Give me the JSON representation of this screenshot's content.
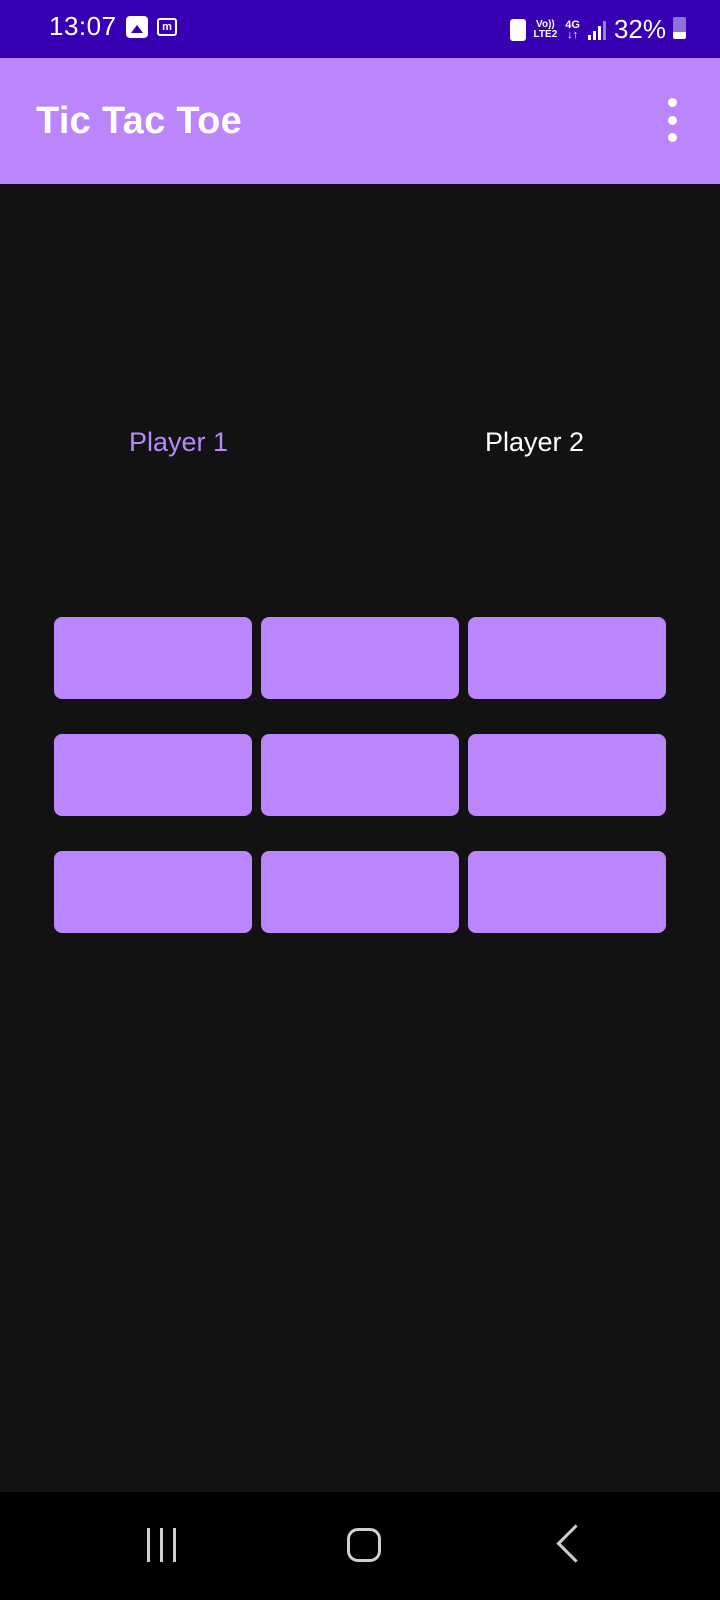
{
  "status_bar": {
    "time": "13:07",
    "left_icons": [
      "gallery-icon",
      "m-app-icon"
    ],
    "m_icon_label": "m",
    "volte_top": "Vo))",
    "volte_bottom": "LTE2",
    "network_type": "4G",
    "battery_percent": "32%",
    "battery_level": 0.32
  },
  "app_bar": {
    "title": "Tic Tac Toe",
    "menu_icon": "more-vert-icon"
  },
  "players": {
    "player_1": "Player 1",
    "player_2": "Player 2"
  },
  "board": {
    "cells": [
      [
        "",
        "",
        ""
      ],
      [
        "",
        "",
        ""
      ],
      [
        "",
        "",
        ""
      ]
    ]
  },
  "nav_bar": {
    "icons": [
      "recent-apps-icon",
      "home-icon",
      "back-icon"
    ]
  },
  "colors": {
    "status_bar": "#3700B3",
    "primary": "#BB86FC",
    "background": "#121212",
    "nav_bar": "#000000",
    "active_player": "#BB86FC",
    "inactive_player": "#FFFFFF"
  }
}
